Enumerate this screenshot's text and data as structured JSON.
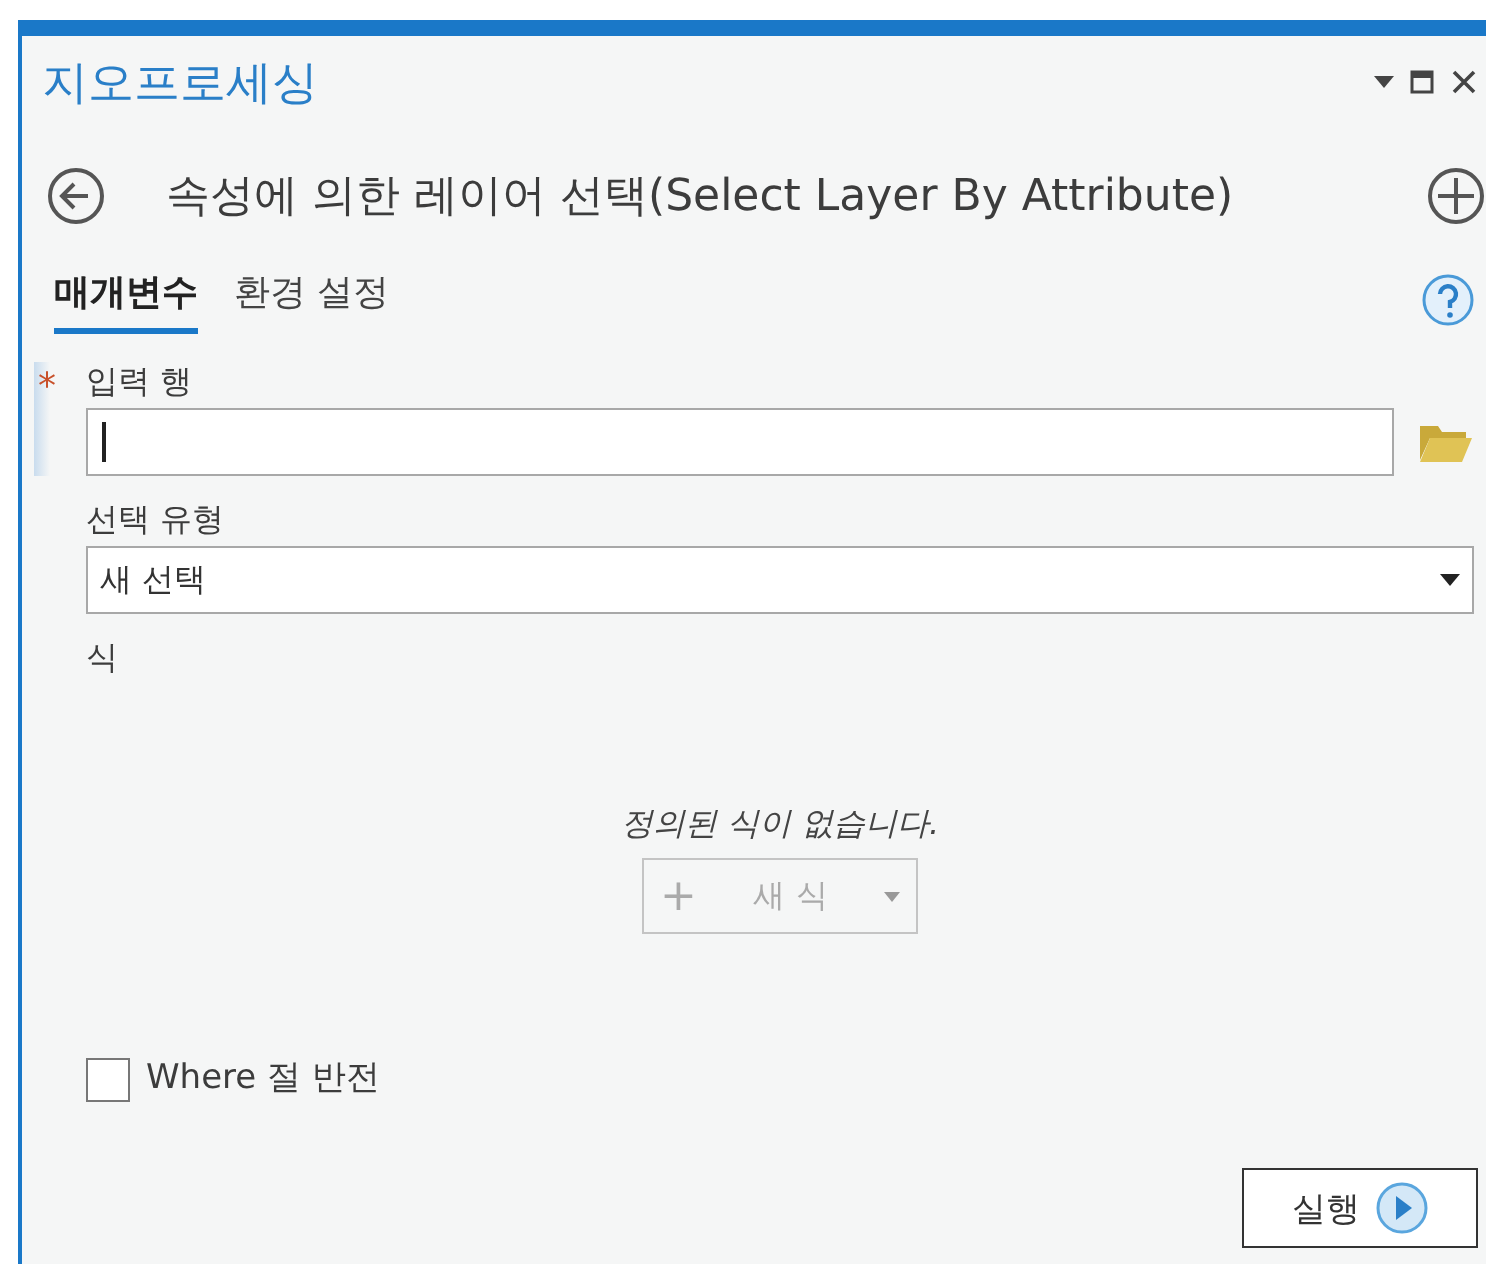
{
  "window": {
    "title": "지오프로세싱"
  },
  "tool": {
    "title": "속성에 의한 레이어 선택(Select Layer By Attribute)"
  },
  "tabs": [
    {
      "label": "매개변수",
      "selected": true
    },
    {
      "label": "환경 설정",
      "selected": false
    }
  ],
  "parameters": [
    {
      "kind": "input",
      "label": "입력 행",
      "required": true,
      "required_mark": "*",
      "focused": true
    },
    {
      "kind": "dropdown",
      "label": "선택 유형",
      "required": false,
      "value": "새 선택"
    },
    {
      "kind": "expression",
      "label": "식",
      "message": "정의된 식이 없습니다.",
      "button": {
        "label": "새 식",
        "icon": "+",
        "disabled": true
      }
    },
    {
      "kind": "checkbox",
      "label": "Where 절 반전",
      "checked": false
    }
  ],
  "run_button": {
    "label": "실행"
  }
}
